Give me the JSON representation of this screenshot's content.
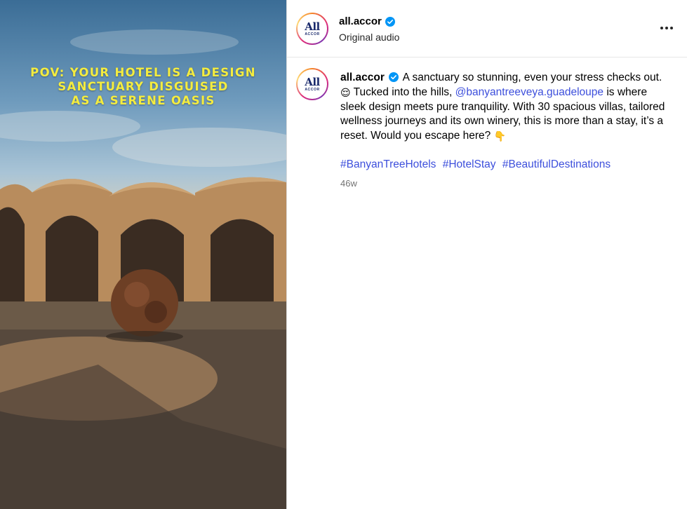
{
  "media": {
    "overlay_lines": [
      "POV: YOUR HOTEL IS A DESIGN",
      "SANCTUARY DISGUISED",
      "AS A SERENE OASIS"
    ]
  },
  "header": {
    "avatar_logo": "All",
    "avatar_sub": "ACCOR",
    "username": "all.accor",
    "subtitle": "Original audio",
    "verified_icon": "verified-badge-icon",
    "more_icon": "more-horizontal-icon"
  },
  "caption": {
    "username": "all.accor",
    "text_1": "A sanctuary so stunning, even your stress checks out.",
    "emoji_1": "😌",
    "text_2": "Tucked into the hills,",
    "mention": "@banyantreeveya.guadeloupe",
    "text_3": "is where sleek design meets pure tranquility. With 30 spacious villas, tailored wellness journeys and its own winery, this is more than a stay, it’s a reset. Would you escape here?",
    "emoji_2": "👇",
    "hashtags": [
      "#BanyanTreeHotels",
      "#HotelStay",
      "#BeautifulDestinations"
    ],
    "time": "46w"
  },
  "colors": {
    "link": "#3d4fdc",
    "overlay_text": "#f4ec3f",
    "verified": "#0095f6"
  }
}
